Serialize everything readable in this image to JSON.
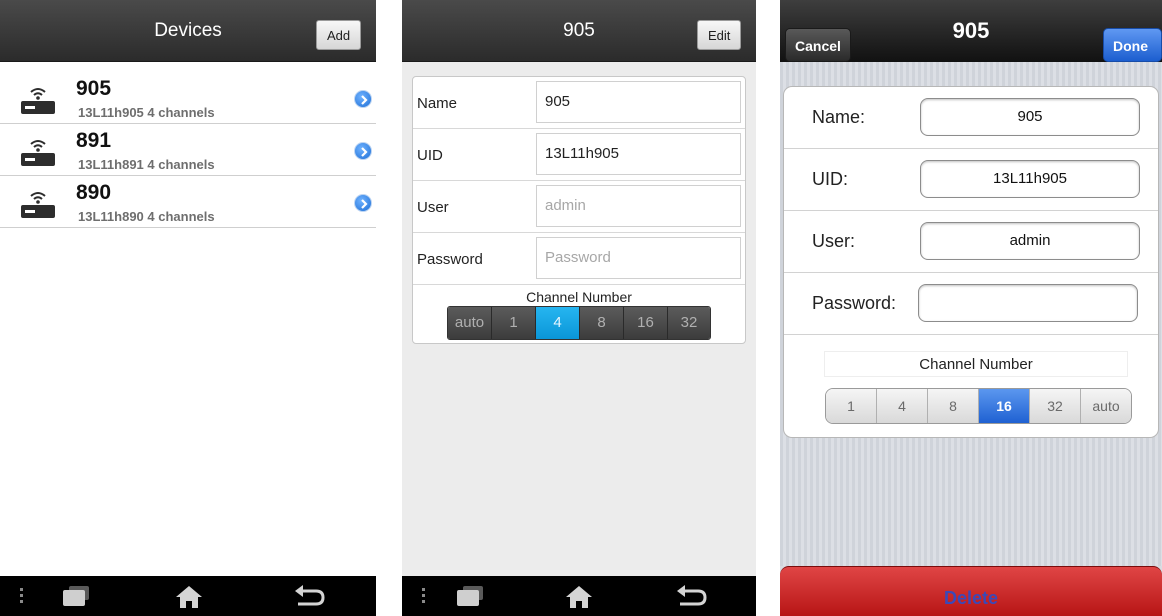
{
  "devices_screen": {
    "title": "Devices",
    "add_label": "Add",
    "items": [
      {
        "name": "905",
        "subtitle": "13L11h905 4 channels"
      },
      {
        "name": "891",
        "subtitle": "13L11h891 4 channels"
      },
      {
        "name": "890",
        "subtitle": "13L11h890 4 channels"
      }
    ]
  },
  "android_edit": {
    "title": "905",
    "edit_label": "Edit",
    "fields": [
      {
        "label": "Name",
        "value": "905"
      },
      {
        "label": "UID",
        "value": "13L11h905"
      },
      {
        "label": "User",
        "placeholder": "admin"
      },
      {
        "label": "Password",
        "placeholder": "Password"
      }
    ],
    "channel_title": "Channel Number",
    "channel_options": [
      "auto",
      "1",
      "4",
      "8",
      "16",
      "32"
    ],
    "channel_selected": "4"
  },
  "ios_edit": {
    "title": "905",
    "cancel_label": "Cancel",
    "done_label": "Done",
    "fields": [
      {
        "label": "Name:",
        "value": "905"
      },
      {
        "label": "UID:",
        "value": "13L11h905"
      },
      {
        "label": "User:",
        "value": "admin"
      },
      {
        "label": "Password:",
        "value": ""
      }
    ],
    "channel_title": "Channel Number",
    "channel_options": [
      "1",
      "4",
      "8",
      "16",
      "32",
      "auto"
    ],
    "channel_selected": "16",
    "delete_label": "Delete"
  },
  "icons": {
    "device": "router-icon",
    "detail": "chevron-right-circle-icon",
    "nav_menu": "menu-dots-icon",
    "nav_recents": "recent-apps-icon",
    "nav_home": "home-icon",
    "nav_back": "back-icon"
  },
  "colors": {
    "android_selected": "#0a96d8",
    "ios_selected": "#1f61d2",
    "delete_red": "#c62020"
  }
}
